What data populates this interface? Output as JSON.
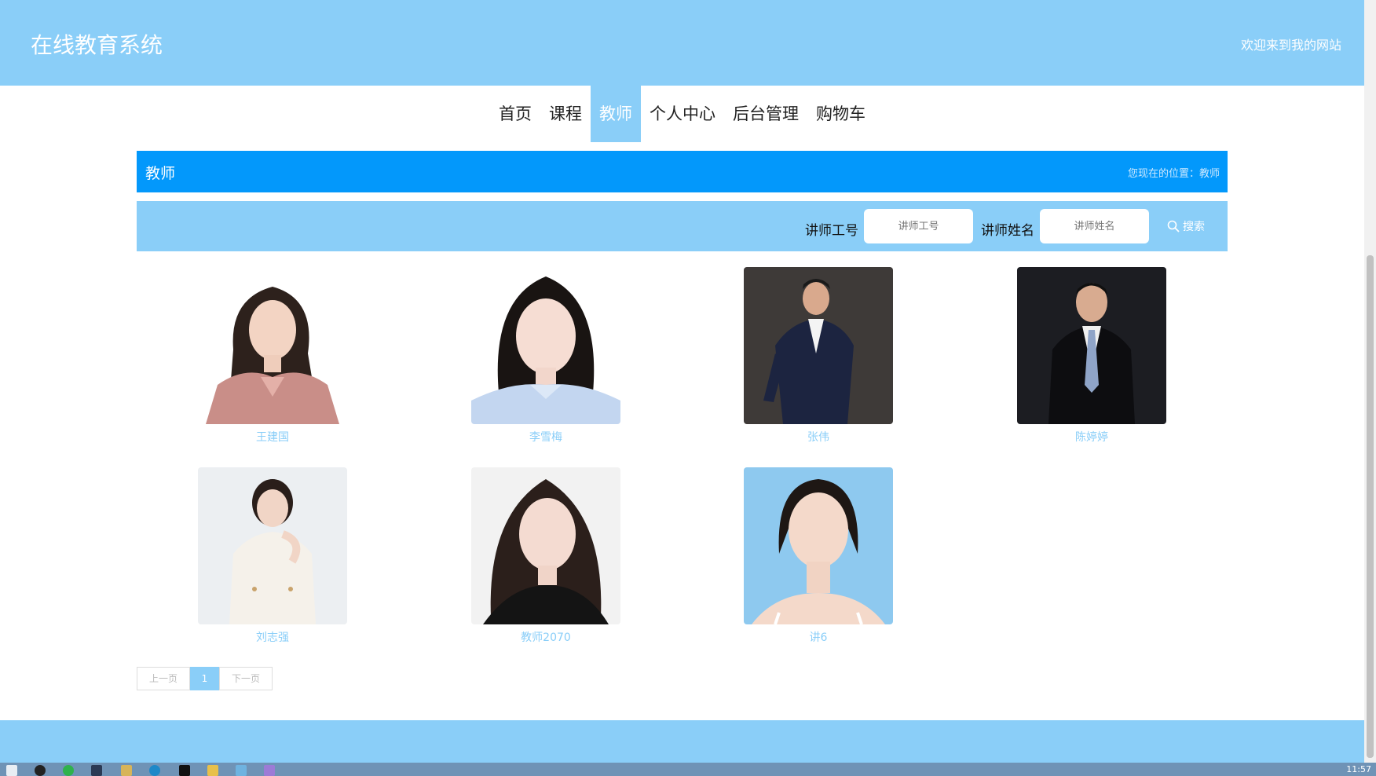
{
  "header": {
    "site_title": "在线教育系统",
    "welcome": "欢迎来到我的网站"
  },
  "nav": [
    {
      "label": "首页",
      "active": false
    },
    {
      "label": "课程",
      "active": false
    },
    {
      "label": "教师",
      "active": true
    },
    {
      "label": "个人中心",
      "active": false
    },
    {
      "label": "后台管理",
      "active": false
    },
    {
      "label": "购物车",
      "active": false
    }
  ],
  "title_bar": {
    "title": "教师",
    "location": "您现在的位置：教师"
  },
  "search": {
    "id_label": "讲师工号",
    "id_placeholder": "讲师工号",
    "name_label": "讲师姓名",
    "name_placeholder": "讲师姓名",
    "button_label": "搜索"
  },
  "teachers": [
    {
      "name": "王建国"
    },
    {
      "name": "李雪梅"
    },
    {
      "name": "张伟"
    },
    {
      "name": "陈婷婷"
    },
    {
      "name": "刘志强"
    },
    {
      "name": "教师2070"
    },
    {
      "name": "讲6"
    }
  ],
  "pager": {
    "prev": "上一页",
    "current": "1",
    "next": "下一页"
  },
  "taskbar": {
    "time": "11:57"
  },
  "colors": {
    "header": "#8acef8",
    "title_bar": "#0398fb",
    "name_text": "#8acef8"
  }
}
